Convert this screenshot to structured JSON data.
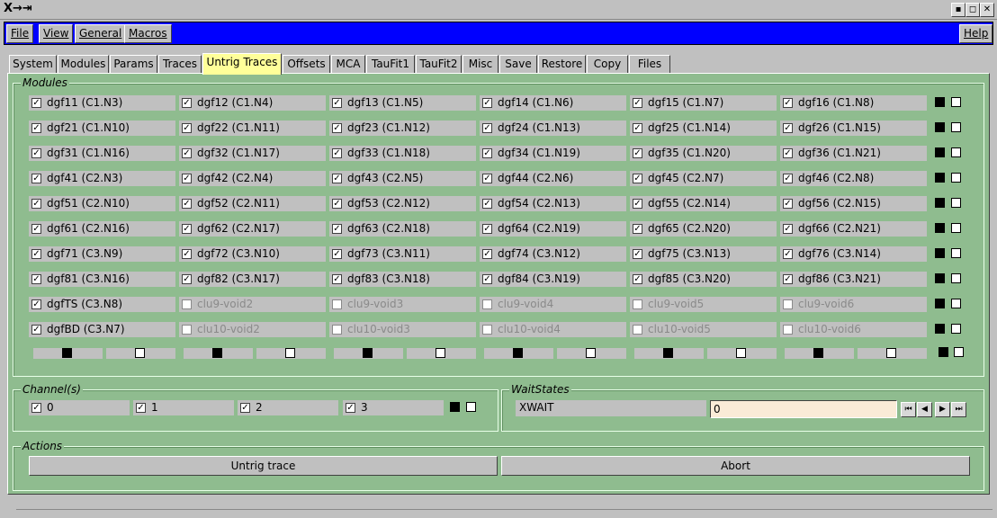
{
  "window": {
    "logo": "X→⇥",
    "buttons": [
      "▪",
      "◻",
      "✕"
    ]
  },
  "menu": {
    "items": [
      "File",
      "View",
      "General",
      "Macros"
    ],
    "help": "Help"
  },
  "tabs": [
    "System",
    "Modules",
    "Params",
    "Traces",
    "Untrig Traces",
    "Offsets",
    "MCA",
    "TauFit1",
    "TauFit2",
    "Misc",
    "Save",
    "Restore",
    "Copy",
    "Files"
  ],
  "active_tab": "Untrig Traces",
  "modules": {
    "label": "Modules",
    "rows": [
      [
        {
          "t": "dgf11 (C1.N3)",
          "c": true
        },
        {
          "t": "dgf12 (C1.N4)",
          "c": true
        },
        {
          "t": "dgf13 (C1.N5)",
          "c": true
        },
        {
          "t": "dgf14 (C1.N6)",
          "c": true
        },
        {
          "t": "dgf15 (C1.N7)",
          "c": true
        },
        {
          "t": "dgf16 (C1.N8)",
          "c": true
        }
      ],
      [
        {
          "t": "dgf21 (C1.N10)",
          "c": true
        },
        {
          "t": "dgf22 (C1.N11)",
          "c": true
        },
        {
          "t": "dgf23 (C1.N12)",
          "c": true
        },
        {
          "t": "dgf24 (C1.N13)",
          "c": true
        },
        {
          "t": "dgf25 (C1.N14)",
          "c": true
        },
        {
          "t": "dgf26 (C1.N15)",
          "c": true
        }
      ],
      [
        {
          "t": "dgf31 (C1.N16)",
          "c": true
        },
        {
          "t": "dgf32 (C1.N17)",
          "c": true
        },
        {
          "t": "dgf33 (C1.N18)",
          "c": true
        },
        {
          "t": "dgf34 (C1.N19)",
          "c": true
        },
        {
          "t": "dgf35 (C1.N20)",
          "c": true
        },
        {
          "t": "dgf36 (C1.N21)",
          "c": true
        }
      ],
      [
        {
          "t": "dgf41 (C2.N3)",
          "c": true
        },
        {
          "t": "dgf42 (C2.N4)",
          "c": true
        },
        {
          "t": "dgf43 (C2.N5)",
          "c": true
        },
        {
          "t": "dgf44 (C2.N6)",
          "c": true
        },
        {
          "t": "dgf45 (C2.N7)",
          "c": true
        },
        {
          "t": "dgf46 (C2.N8)",
          "c": true
        }
      ],
      [
        {
          "t": "dgf51 (C2.N10)",
          "c": true
        },
        {
          "t": "dgf52 (C2.N11)",
          "c": true
        },
        {
          "t": "dgf53 (C2.N12)",
          "c": true
        },
        {
          "t": "dgf54 (C2.N13)",
          "c": true
        },
        {
          "t": "dgf55 (C2.N14)",
          "c": true
        },
        {
          "t": "dgf56 (C2.N15)",
          "c": true
        }
      ],
      [
        {
          "t": "dgf61 (C2.N16)",
          "c": true
        },
        {
          "t": "dgf62 (C2.N17)",
          "c": true
        },
        {
          "t": "dgf63 (C2.N18)",
          "c": true
        },
        {
          "t": "dgf64 (C2.N19)",
          "c": true
        },
        {
          "t": "dgf65 (C2.N20)",
          "c": true
        },
        {
          "t": "dgf66 (C2.N21)",
          "c": true
        }
      ],
      [
        {
          "t": "dgf71 (C3.N9)",
          "c": true
        },
        {
          "t": "dgf72 (C3.N10)",
          "c": true
        },
        {
          "t": "dgf73 (C3.N11)",
          "c": true
        },
        {
          "t": "dgf74 (C3.N12)",
          "c": true
        },
        {
          "t": "dgf75 (C3.N13)",
          "c": true
        },
        {
          "t": "dgf76 (C3.N14)",
          "c": true
        }
      ],
      [
        {
          "t": "dgf81 (C3.N16)",
          "c": true
        },
        {
          "t": "dgf82 (C3.N17)",
          "c": true
        },
        {
          "t": "dgf83 (C3.N18)",
          "c": true
        },
        {
          "t": "dgf84 (C3.N19)",
          "c": true
        },
        {
          "t": "dgf85 (C3.N20)",
          "c": true
        },
        {
          "t": "dgf86 (C3.N21)",
          "c": true
        }
      ],
      [
        {
          "t": "dgfTS (C3.N8)",
          "c": true
        },
        {
          "t": "clu9-void2",
          "c": false,
          "d": true
        },
        {
          "t": "clu9-void3",
          "c": false,
          "d": true
        },
        {
          "t": "clu9-void4",
          "c": false,
          "d": true
        },
        {
          "t": "clu9-void5",
          "c": false,
          "d": true
        },
        {
          "t": "clu9-void6",
          "c": false,
          "d": true
        }
      ],
      [
        {
          "t": "dgfBD (C3.N7)",
          "c": true
        },
        {
          "t": "clu10-void2",
          "c": false,
          "d": true
        },
        {
          "t": "clu10-void3",
          "c": false,
          "d": true
        },
        {
          "t": "clu10-void4",
          "c": false,
          "d": true
        },
        {
          "t": "clu10-void5",
          "c": false,
          "d": true
        },
        {
          "t": "clu10-void6",
          "c": false,
          "d": true
        }
      ]
    ]
  },
  "channels": {
    "label": "Channel(s)",
    "items": [
      {
        "t": "0",
        "c": true
      },
      {
        "t": "1",
        "c": true
      },
      {
        "t": "2",
        "c": true
      },
      {
        "t": "3",
        "c": true
      }
    ]
  },
  "waitstates": {
    "label": "WaitStates",
    "name": "XWAIT",
    "value": "0"
  },
  "actions": {
    "label": "Actions",
    "untrig": "Untrig trace",
    "abort": "Abort"
  },
  "colors": {
    "panel": "#8fbc8f",
    "menubar": "#0000ff",
    "active_tab": "#ffff99",
    "entry": "#faebd7"
  }
}
